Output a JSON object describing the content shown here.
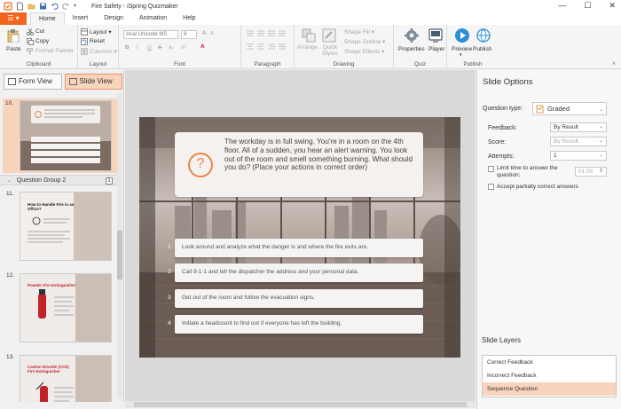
{
  "window": {
    "title": "Fire Safety - iSpring Quizmaker",
    "minimize": "—",
    "maximize": "☐",
    "close": "✕"
  },
  "file_button": "☰ ▾",
  "tabs": [
    "Home",
    "Insert",
    "Design",
    "Animation",
    "Help"
  ],
  "ribbon": {
    "clipboard": {
      "label": "Clipboard",
      "paste": "Paste",
      "cut": "Cut",
      "copy": "Copy",
      "format_painter": "Format Painter"
    },
    "layout": {
      "label": "Layout",
      "layout": "Layout ▾",
      "reset": "Reset",
      "columns": "Columns ▾"
    },
    "font": {
      "label": "Font",
      "family": "Arial Unicode MS",
      "size": "8",
      "bold": "B",
      "italic": "I",
      "underline": "U",
      "strike": "S",
      "sub": "x₂",
      "sup": "x²",
      "grow": "A",
      "shrink": "A",
      "color": "A"
    },
    "paragraph": {
      "label": "Paragraph"
    },
    "drawing": {
      "label": "Drawing",
      "arrange": "Arrange",
      "quick_styles": "Quick Styles",
      "shape_fill": "Shape Fill ▾",
      "shape_outline": "Shape Outline ▾",
      "shape_effects": "Shape Effects ▾"
    },
    "quiz": {
      "label": "Quiz",
      "properties": "Properties",
      "player": "Player"
    },
    "publish": {
      "label": "Publish",
      "preview": "Preview",
      "publish": "Publish"
    }
  },
  "view_toggle": {
    "form": "Form View",
    "slide": "Slide View"
  },
  "slides": [
    {
      "num": "10.",
      "title": ""
    },
    {
      "num": "11.",
      "title": "How to Handle Fire in an Office?"
    },
    {
      "num": "12.",
      "title": "Powder Fire Extinguisher"
    },
    {
      "num": "13.",
      "title": "Carbon Dioxide (CO2) Fire Extinguisher"
    }
  ],
  "question_group": {
    "label": "Question Group 2",
    "count": "1"
  },
  "slide_content": {
    "question_icon": "?",
    "question": "The workday is in full swing. You're in a room on the 4th floor. All of a sudden, you hear an alert warning. You look out of the room and smell something burning. What should you do? (Place your actions in correct order)",
    "answers": [
      {
        "num": "1",
        "text": "Look around and analyze what the danger is and where the fire exits are."
      },
      {
        "num": "2",
        "text": "Call 9-1-1 and tell the dispatcher the address and your personal data."
      },
      {
        "num": "3",
        "text": "Get out of the room and follow the evacuation signs."
      },
      {
        "num": "4",
        "text": "Initiate a headcount to find out if everyone has left the building."
      }
    ]
  },
  "slide_options": {
    "title": "Slide Options",
    "question_type_label": "Question type:",
    "question_type_value": "Graded",
    "feedback_label": "Feedback:",
    "feedback_value": "By Result",
    "score_label": "Score:",
    "score_value": "By Result",
    "attempts_label": "Attempts:",
    "attempts_value": "1",
    "limit_time_label": "Limit time to answer the question:",
    "limit_time_value": "01:00",
    "partial_label": "Accept partially correct answers"
  },
  "slide_layers": {
    "title": "Slide Layers",
    "items": [
      "Correct Feedback",
      "Incorrect Feedback",
      "Sequence Question"
    ]
  },
  "colors": {
    "accent": "#f0661e",
    "selection": "#f8d4bd"
  }
}
